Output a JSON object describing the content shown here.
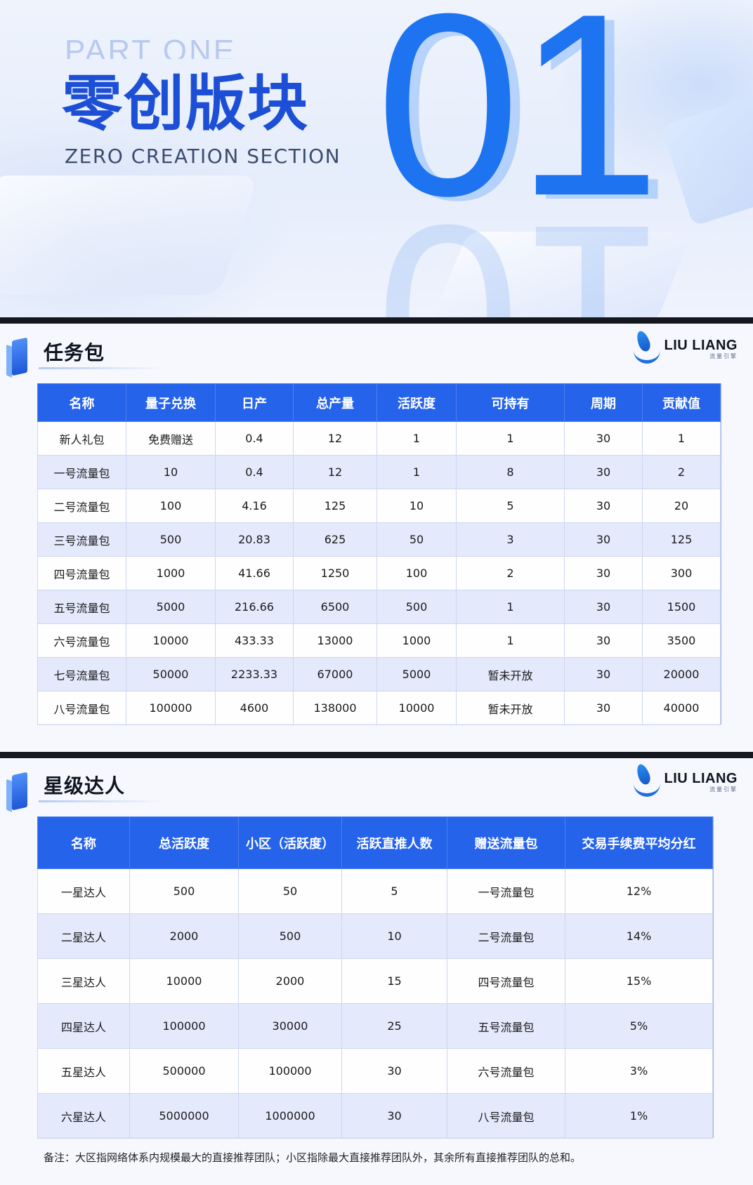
{
  "hero": {
    "part_label": "PART ONE",
    "title": "零创版块",
    "subtitle": "ZERO CREATION SECTION",
    "big_number": "01"
  },
  "brand": {
    "name": "LIU LIANG",
    "sub": "流量引擎"
  },
  "task_section": {
    "title": "任务包",
    "headers": [
      "名称",
      "量子兑换",
      "日产",
      "总产量",
      "活跃度",
      "可持有",
      "周期",
      "贡献值"
    ],
    "rows": [
      [
        "新人礼包",
        "免费赠送",
        "0.4",
        "12",
        "1",
        "1",
        "30",
        "1"
      ],
      [
        "一号流量包",
        "10",
        "0.4",
        "12",
        "1",
        "8",
        "30",
        "2"
      ],
      [
        "二号流量包",
        "100",
        "4.16",
        "125",
        "10",
        "5",
        "30",
        "20"
      ],
      [
        "三号流量包",
        "500",
        "20.83",
        "625",
        "50",
        "3",
        "30",
        "125"
      ],
      [
        "四号流量包",
        "1000",
        "41.66",
        "1250",
        "100",
        "2",
        "30",
        "300"
      ],
      [
        "五号流量包",
        "5000",
        "216.66",
        "6500",
        "500",
        "1",
        "30",
        "1500"
      ],
      [
        "六号流量包",
        "10000",
        "433.33",
        "13000",
        "1000",
        "1",
        "30",
        "3500"
      ],
      [
        "七号流量包",
        "50000",
        "2233.33",
        "67000",
        "5000",
        "暂未开放",
        "30",
        "20000"
      ],
      [
        "八号流量包",
        "100000",
        "4600",
        "138000",
        "10000",
        "暂未开放",
        "30",
        "40000"
      ]
    ]
  },
  "star_section": {
    "title": "星级达人",
    "headers": [
      "名称",
      "总活跃度",
      "小区（活跃度）",
      "活跃直推人数",
      "赠送流量包",
      "交易手续费平均分红"
    ],
    "rows": [
      [
        "一星达人",
        "500",
        "50",
        "5",
        "一号流量包",
        "12%"
      ],
      [
        "二星达人",
        "2000",
        "500",
        "10",
        "二号流量包",
        "14%"
      ],
      [
        "三星达人",
        "10000",
        "2000",
        "15",
        "四号流量包",
        "15%"
      ],
      [
        "四星达人",
        "100000",
        "30000",
        "25",
        "五号流量包",
        "5%"
      ],
      [
        "五星达人",
        "500000",
        "100000",
        "30",
        "六号流量包",
        "3%"
      ],
      [
        "六星达人",
        "5000000",
        "1000000",
        "30",
        "八号流量包",
        "1%"
      ]
    ]
  },
  "note": "备注：大区指网络体系内规模最大的直接推荐团队；小区指除最大直接推荐团队外，其余所有直接推荐团队的总和。"
}
